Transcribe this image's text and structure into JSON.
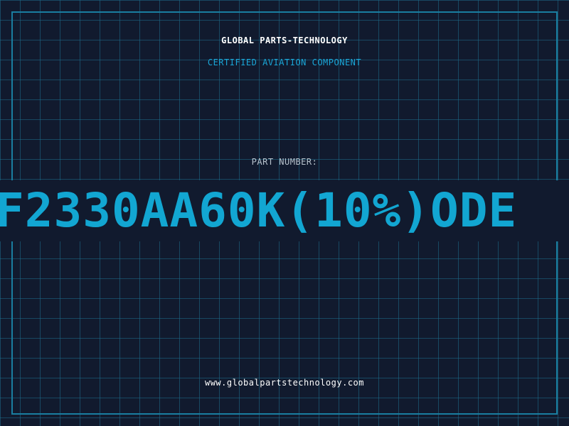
{
  "header": {
    "company": "GLOBAL PARTS-TECHNOLOGY",
    "subtitle": "CERTIFIED AVIATION COMPONENT"
  },
  "part": {
    "label": "PART NUMBER:",
    "number": "F2330AA60K(10%)ODE"
  },
  "footer": {
    "url": "www.globalpartstechnology.com"
  },
  "colors": {
    "background": "#111a2e",
    "grid": "#1e6e8c",
    "accent": "#12a6d2",
    "border": "#1a7ea0"
  }
}
